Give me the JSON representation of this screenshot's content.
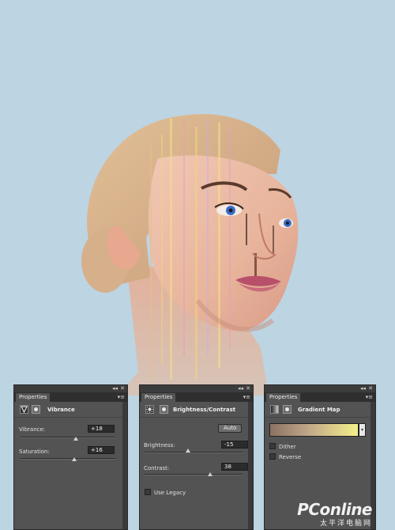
{
  "panels": [
    {
      "tab": "Properties",
      "title": "Vibrance",
      "adjustment_icon": "vibrance-triangle-icon",
      "sliders": [
        {
          "label": "Vibrance:",
          "value": "+18",
          "level": 0.59
        },
        {
          "label": "Saturation:",
          "value": "+16",
          "level": 0.58
        }
      ]
    },
    {
      "tab": "Properties",
      "title": "Brightness/Contrast",
      "adjustment_icon": "brightness-sun-icon",
      "auto_button": "Auto",
      "sliders": [
        {
          "label": "Brightness:",
          "value": "-15",
          "level": 0.45
        },
        {
          "label": "Contrast:",
          "value": "38",
          "level": 0.68
        }
      ],
      "checkbox": {
        "label": "Use Legacy",
        "checked": false
      }
    },
    {
      "tab": "Properties",
      "title": "Gradient Map",
      "adjustment_icon": "gradient-map-icon",
      "gradient_colors": [
        "#8a7262",
        "#c3a98a",
        "#f4f08a"
      ],
      "checkboxes": [
        {
          "label": "Dither",
          "checked": false
        },
        {
          "label": "Reverse",
          "checked": false
        }
      ]
    }
  ],
  "panel_controls": {
    "collapse": "◂◂",
    "close": "✕",
    "menu": "▾≡"
  },
  "watermark": {
    "logo": "PConline",
    "sub": "太平洋电脑网"
  },
  "colors": {
    "background": "#bdd4e3",
    "panel": "#535353",
    "panel_dark": "#2f2f2f"
  }
}
